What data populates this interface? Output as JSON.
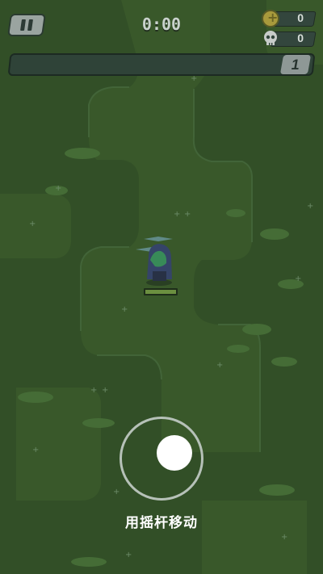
{
  "hud": {
    "timer": "0:00",
    "coins": "0",
    "kills": "0",
    "level": "1",
    "xp_progress": 0
  },
  "controls": {
    "hint": "用摇杆移动"
  },
  "icons": {
    "pause": "pause-icon",
    "coin": "coin-icon",
    "kills": "skull-icon"
  },
  "colors": {
    "grass": "#37572b",
    "path": "#456a36",
    "hud_panel": "#2f4338",
    "text": "#d6ddd8"
  }
}
